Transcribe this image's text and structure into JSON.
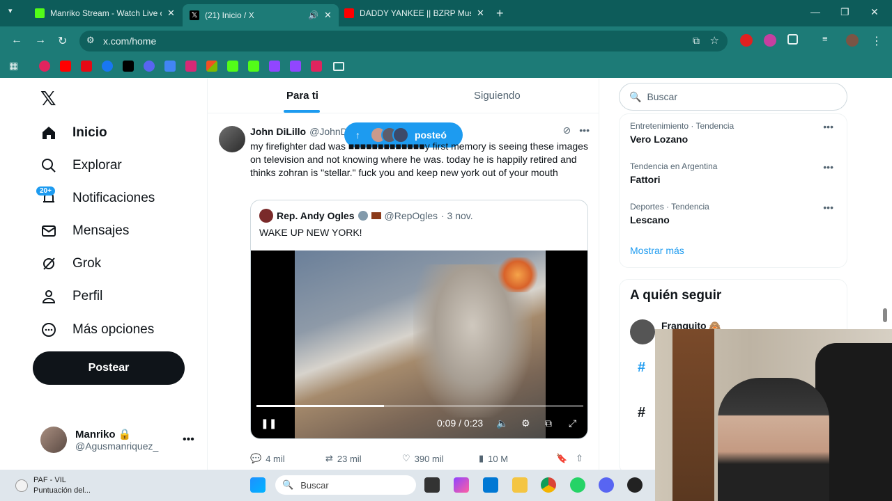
{
  "browser": {
    "tabs": [
      {
        "title": "Manriko Stream - Watch Live o",
        "favicon_color": "#53fc18",
        "close": "✕"
      },
      {
        "title": "(21) Inicio / X",
        "favicon_color": "#000000",
        "close": "✕"
      },
      {
        "title": "DADDY YANKEE || BZRP Music S",
        "favicon_color": "#ff0000",
        "close": "✕"
      }
    ],
    "url": "x.com/home"
  },
  "sidebar": {
    "items": [
      {
        "label": "Inicio",
        "icon": "home-icon"
      },
      {
        "label": "Explorar",
        "icon": "search-icon"
      },
      {
        "label": "Notificaciones",
        "icon": "bell-icon"
      },
      {
        "label": "Mensajes",
        "icon": "mail-icon"
      },
      {
        "label": "Grok",
        "icon": "grok-icon"
      },
      {
        "label": "Perfil",
        "icon": "person-icon"
      },
      {
        "label": "Más opciones",
        "icon": "more-circle-icon"
      }
    ],
    "notif_badge": "20+",
    "post_button": "Postear",
    "account": {
      "name": "Manriko 🔒",
      "handle": "@Agusmanriquez_"
    }
  },
  "feed": {
    "tabs": [
      "Para ti",
      "Siguiendo"
    ],
    "posted_pill": "posteó",
    "tweet": {
      "name": "John DiLillo",
      "handle": "@JohnDi",
      "text": "my firefighter dad was ■■■■■■■■■■■■■y first memory is seeing these images on television and not knowing where he was. today he is happily retired and thinks zohran is \"stellar.\" fuck you and keep new york out of your mouth",
      "quote": {
        "name": "Rep. Andy Ogles",
        "handle": "@RepOgles",
        "date": "· 3 nov.",
        "text": "WAKE UP NEW YORK!",
        "video_time": "0:09 / 0:23",
        "progress": 0.39
      },
      "stats": {
        "replies": "4 mil",
        "reposts": "23 mil",
        "likes": "390 mil",
        "views": "10 M"
      }
    }
  },
  "right": {
    "search_placeholder": "Buscar",
    "trends": [
      {
        "category": "Entretenimiento · Tendencia",
        "name": "Vero Lozano"
      },
      {
        "category": "Tendencia en Argentina",
        "name": "Fattori"
      },
      {
        "category": "Deportes · Tendencia",
        "name": "Lescano"
      }
    ],
    "show_more": "Mostrar más",
    "who_to_follow_title": "A quién seguir",
    "follow_name": "Franguito 🙈"
  },
  "taskbar": {
    "news_title": "PAF - VIL",
    "news_sub": "Puntuación del...",
    "search": "Buscar"
  }
}
